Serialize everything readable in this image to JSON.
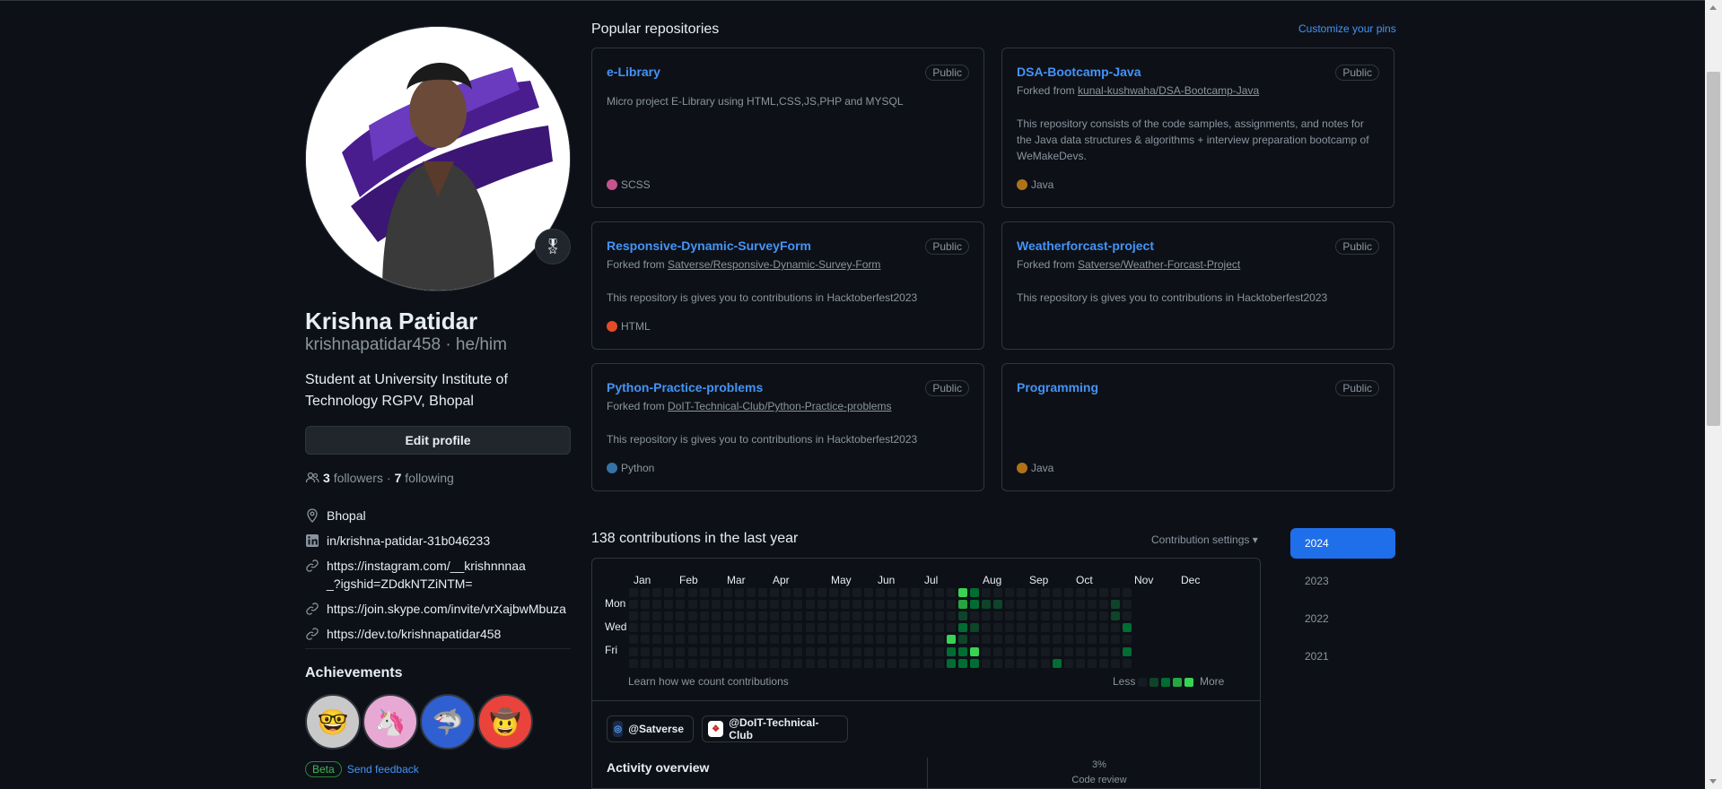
{
  "profile": {
    "name": "Krishna Patidar",
    "login_line": "krishnapatidar458 · he/him",
    "bio": "Student at University Institute of Technology RGPV, Bhopal",
    "edit_label": "Edit profile",
    "followers_count": "3",
    "followers_label": "followers",
    "sep": "·",
    "following_count": "7",
    "following_label": "following",
    "details": {
      "location": "Bhopal",
      "linkedin": "in/krishna-patidar-31b046233",
      "link1": "https://instagram.com/__krishnnnaa_?igshid=ZDdkNTZiNTM=",
      "link2": "https://join.skype.com/invite/vrXajbwMbuza",
      "link3": "https://dev.to/krishnapatidar458"
    },
    "achievements_title": "Achievements",
    "beta_label": "Beta",
    "feedback_label": "Send feedback"
  },
  "popular": {
    "title": "Popular repositories",
    "customize": "Customize your pins",
    "badge": "Public",
    "forked_prefix": "Forked from",
    "repos": [
      {
        "name": "e-Library",
        "fork": "",
        "desc": "Micro project E-Library using HTML,CSS,JS,PHP and MYSQL",
        "lang": "SCSS"
      },
      {
        "name": "DSA-Bootcamp-Java",
        "fork": "kunal-kushwaha/DSA-Bootcamp-Java",
        "desc": "This repository consists of the code samples, assignments, and notes for the Java data structures & algorithms + interview preparation bootcamp of WeMakeDevs.",
        "lang": "Java"
      },
      {
        "name": "Responsive-Dynamic-SurveyForm",
        "fork": "Satverse/Responsive-Dynamic-Survey-Form",
        "desc": "This repository is gives you to contributions in Hacktoberfest2023",
        "lang": "HTML"
      },
      {
        "name": "Weatherforcast-project",
        "fork": "Satverse/Weather-Forcast-Project",
        "desc": "This repository is gives you to contributions in Hacktoberfest2023",
        "lang": ""
      },
      {
        "name": "Python-Practice-problems",
        "fork": "DoIT-Technical-Club/Python-Practice-problems",
        "desc": "This repository is gives you to contributions in Hacktoberfest2023",
        "lang": "Python"
      },
      {
        "name": "Programming",
        "fork": "",
        "desc": "",
        "lang": "Java"
      }
    ],
    "lang_colors": {
      "SCSS": "#c6538c",
      "Java": "#b07219",
      "HTML": "#e34c26",
      "Python": "#3572A5"
    }
  },
  "contributions": {
    "title": "138 contributions in the last year",
    "settings": "Contribution settings ▾",
    "months": [
      "Jan",
      "Feb",
      "Mar",
      "Apr",
      "May",
      "Jun",
      "Jul",
      "Aug",
      "Sep",
      "Oct",
      "Nov",
      "Dec"
    ],
    "days": [
      "Mon",
      "Wed",
      "Fri"
    ],
    "learn": "Learn how we count contributions",
    "less": "Less",
    "more": "More",
    "levels_colors": [
      "#161b22",
      "#0e4429",
      "#006d32",
      "#26a641",
      "#39d353"
    ],
    "active_cells": [
      {
        "week": 38,
        "day": 0,
        "level": 4
      },
      {
        "week": 38,
        "day": 1,
        "level": 3
      },
      {
        "week": 38,
        "day": 2,
        "level": 1
      },
      {
        "week": 38,
        "day": 3,
        "level": 2
      },
      {
        "week": 38,
        "day": 4,
        "level": 1
      },
      {
        "week": 38,
        "day": 5,
        "level": 2
      },
      {
        "week": 38,
        "day": 6,
        "level": 2
      },
      {
        "week": 37,
        "day": 4,
        "level": 4
      },
      {
        "week": 37,
        "day": 5,
        "level": 2
      },
      {
        "week": 37,
        "day": 6,
        "level": 2
      },
      {
        "week": 39,
        "day": 0,
        "level": 2
      },
      {
        "week": 39,
        "day": 1,
        "level": 2
      },
      {
        "week": 39,
        "day": 5,
        "level": 4
      },
      {
        "week": 39,
        "day": 6,
        "level": 2
      },
      {
        "week": 40,
        "day": 1,
        "level": 1
      },
      {
        "week": 41,
        "day": 1,
        "level": 1
      },
      {
        "week": 39,
        "day": 3,
        "level": 1
      },
      {
        "week": 46,
        "day": 6,
        "level": 2
      },
      {
        "week": 51,
        "day": 1,
        "level": 1
      },
      {
        "week": 51,
        "day": 2,
        "level": 1
      },
      {
        "week": 52,
        "day": 3,
        "level": 2
      },
      {
        "week": 52,
        "day": 5,
        "level": 2
      }
    ],
    "orgs": [
      {
        "label": "@Satverse"
      },
      {
        "label": "@DoIT-Technical-Club"
      }
    ],
    "activity_title": "Activity overview",
    "code_review_pct": "3%",
    "code_review_label": "Code review"
  },
  "years": [
    "2024",
    "2023",
    "2022",
    "2021"
  ]
}
